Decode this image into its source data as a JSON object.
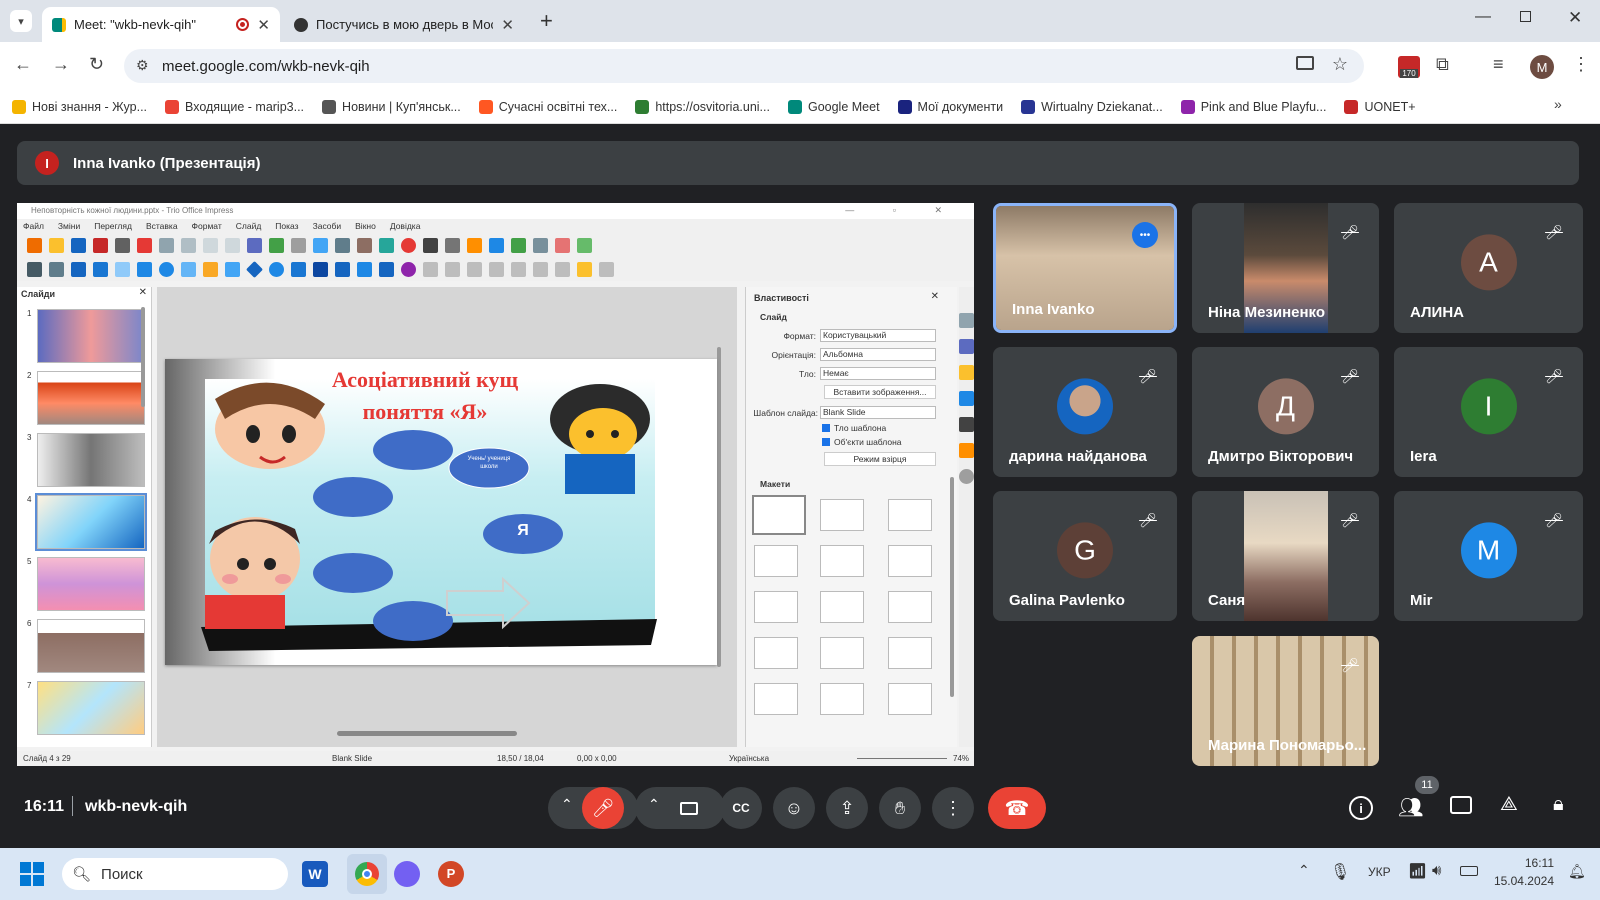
{
  "browser": {
    "tabs": [
      {
        "title": "Meet: \"wkb-nevk-qih\"",
        "active": true
      },
      {
        "title": "Постучись в мою дверь в Мос",
        "active": false
      }
    ],
    "url": "meet.google.com/wkb-nevk-qih",
    "ext_badge": "170",
    "profile_letter": "M",
    "bookmarks": [
      {
        "label": "Нові знання - Жур...",
        "color": "#f4b400"
      },
      {
        "label": "Входящие - marip3...",
        "color": "#ea4335"
      },
      {
        "label": "Новини | Куп'янськ...",
        "color": "#555555"
      },
      {
        "label": "Сучасні освітні тех...",
        "color": "#ff5722"
      },
      {
        "label": "https://osvitoria.uni...",
        "color": "#2e7d32"
      },
      {
        "label": "Google Meet",
        "color": "#00897b"
      },
      {
        "label": "Мої документи",
        "color": "#1a237e"
      },
      {
        "label": "Wirtualny Dziekanat...",
        "color": "#283593"
      },
      {
        "label": "Pink and Blue Playfu...",
        "color": "#8e24aa"
      },
      {
        "label": "UONET+",
        "color": "#c62828"
      }
    ]
  },
  "meet": {
    "presenter_initial": "I",
    "presenter_label": "Inna Ivanko (Презентація)",
    "time": "16:11",
    "meeting_code": "wkb-nevk-qih",
    "participants_count": "11",
    "participants": [
      {
        "name": "Inna Ivanko",
        "initial": "",
        "color": "#5f6368",
        "video": true,
        "muted": false
      },
      {
        "name": "Ніна Мезиненко",
        "initial": "",
        "color": "#5f6368",
        "video": true,
        "muted": true
      },
      {
        "name": "АЛИНА",
        "initial": "А",
        "color": "#6d4c41",
        "video": false,
        "muted": true
      },
      {
        "name": "дарина найданова",
        "initial": "",
        "color": "#1565c0",
        "video": false,
        "muted": true
      },
      {
        "name": "Дмитро Вікторович",
        "initial": "Д",
        "color": "#8d6e63",
        "video": false,
        "muted": true
      },
      {
        "name": "Iera",
        "initial": "I",
        "color": "#2e7d32",
        "video": false,
        "muted": true
      },
      {
        "name": "Galina Pavlenko",
        "initial": "G",
        "color": "#5d4037",
        "video": false,
        "muted": true
      },
      {
        "name": "Саня",
        "initial": "",
        "color": "#5f6368",
        "video": true,
        "muted": true
      },
      {
        "name": "Mir",
        "initial": "M",
        "color": "#1e88e5",
        "video": false,
        "muted": true
      },
      {
        "name": "Марина Пономарьо...",
        "initial": "",
        "color": "#5f6368",
        "video": true,
        "muted": true
      }
    ]
  },
  "impress": {
    "title": "Неповторність кожної людини.pptx - Trio Office Impress",
    "menu": [
      "Файл",
      "Зміни",
      "Перегляд",
      "Вставка",
      "Формат",
      "Слайд",
      "Показ",
      "Засоби",
      "Вікно",
      "Довідка"
    ],
    "slides_label": "Слайди",
    "slide_title_line1": "Асоціативний кущ",
    "slide_title_line2": "поняття «Я»",
    "bubble_text": "Учень/ учениця школи",
    "center_text": "Я",
    "props": {
      "header": "Властивості",
      "section_slide": "Слайд",
      "format_label": "Формат:",
      "format_value": "Користувацький",
      "orient_label": "Орієнтація:",
      "orient_value": "Альбомна",
      "bg_label": "Тло:",
      "bg_value": "Немає",
      "insert_image": "Вставити зображення...",
      "template_label": "Шаблон слайда:",
      "template_value": "Blank Slide",
      "cb1": "Тло шаблона",
      "cb2": "Об'єкти шаблона",
      "master_mode": "Режим взірця",
      "section_layouts": "Макети"
    },
    "status": {
      "slide_of": "Слайд 4 з 29",
      "template": "Blank Slide",
      "pos": "18,50 / 18,04",
      "size": "0,00 x 0,00",
      "lang": "Українська",
      "zoom": "74%"
    }
  },
  "taskbar": {
    "search_placeholder": "Поиск",
    "lang": "УКР",
    "time": "16:11",
    "date": "15.04.2024"
  }
}
